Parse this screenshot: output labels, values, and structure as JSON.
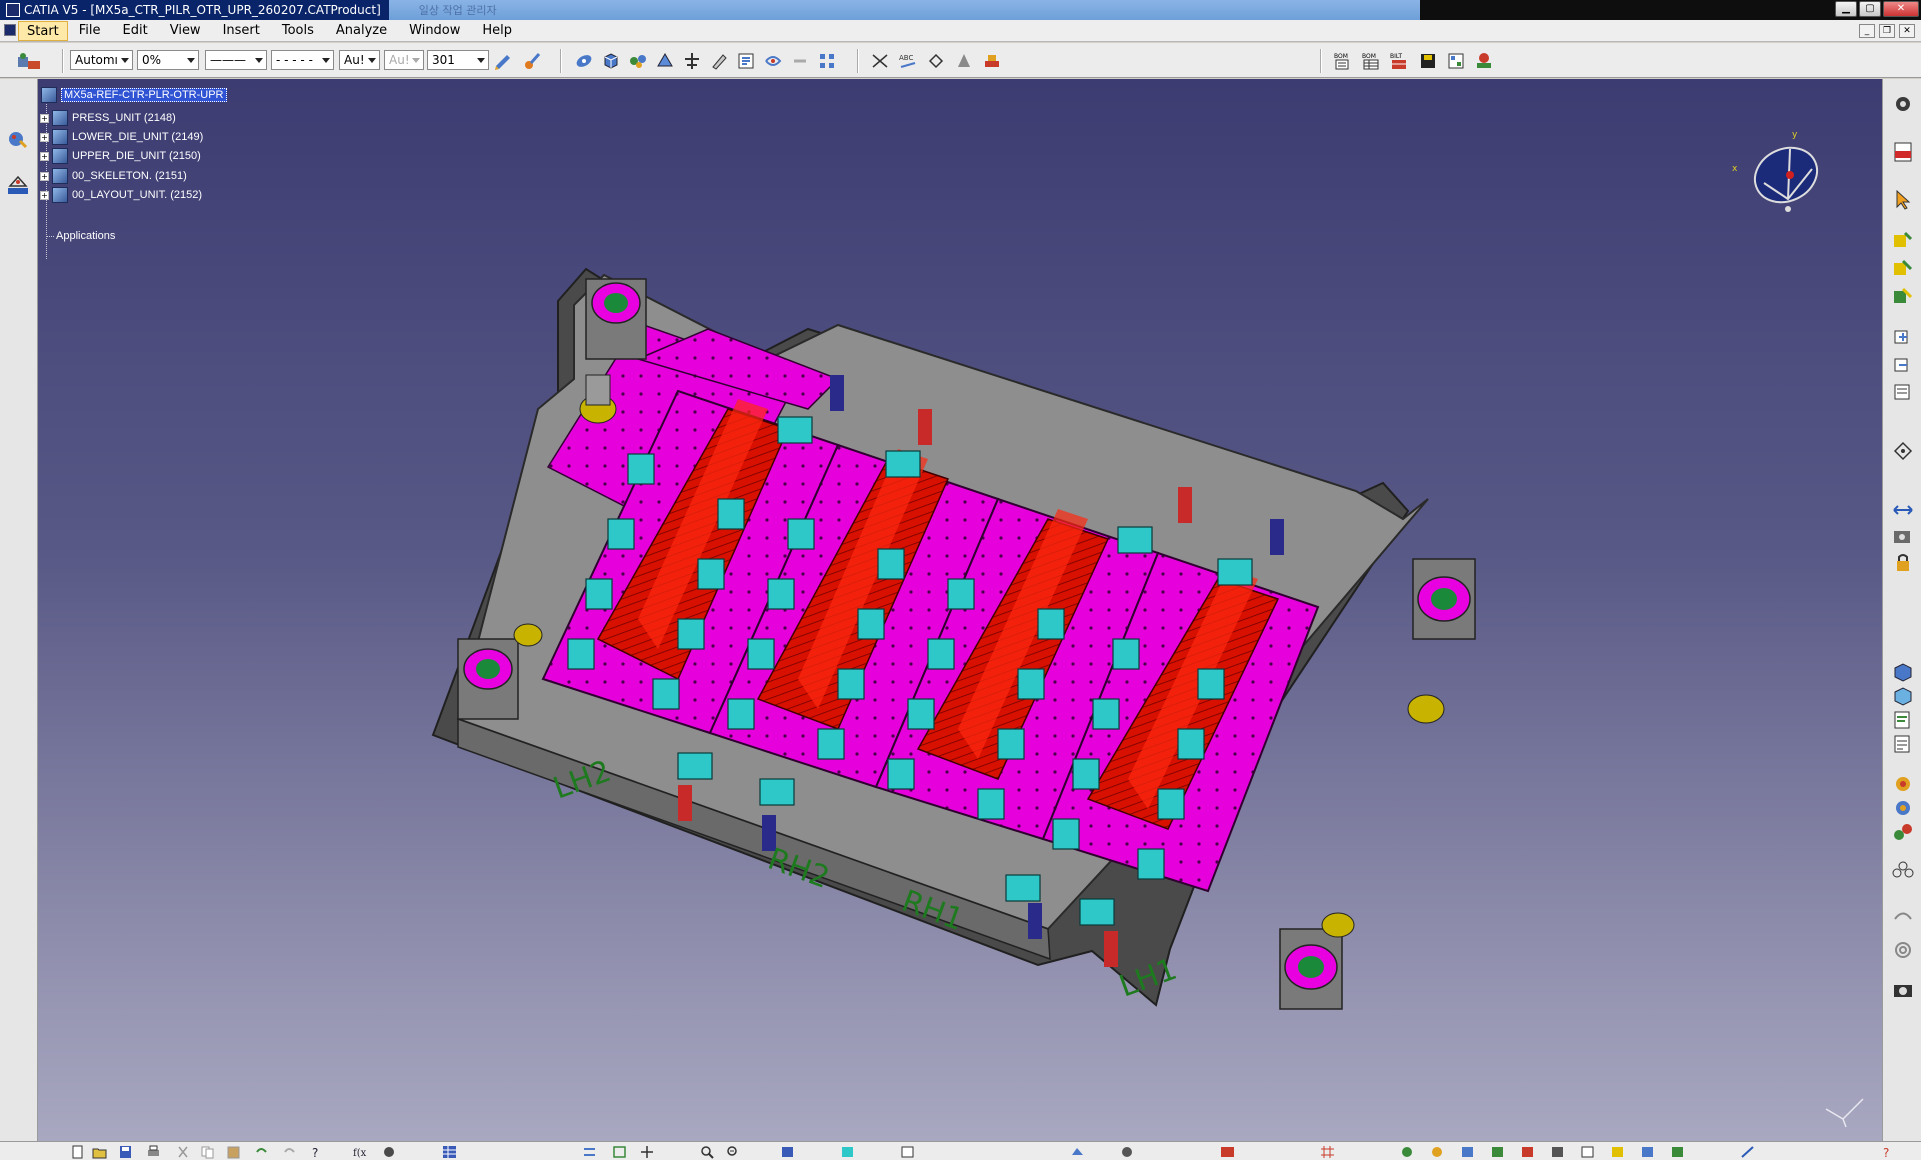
{
  "window": {
    "title": "CATIA V5 - [MX5a_CTR_PILR_OTR_UPR_260207.CATProduct]",
    "ghost_title": "일상 작업 관리자"
  },
  "menu": {
    "items": [
      {
        "key": "start",
        "label": "Start"
      },
      {
        "key": "file",
        "label": "File"
      },
      {
        "key": "edit",
        "label": "Edit"
      },
      {
        "key": "view",
        "label": "View"
      },
      {
        "key": "insert",
        "label": "Insert"
      },
      {
        "key": "tools",
        "label": "Tools"
      },
      {
        "key": "analyze",
        "label": "Analyze"
      },
      {
        "key": "window",
        "label": "Window"
      },
      {
        "key": "help",
        "label": "Help"
      }
    ]
  },
  "toolbar": {
    "color_select": "Automı",
    "transparency_select": "0%",
    "line_weight_select": "———",
    "line_type_select": "- - - - -",
    "point_select": "Au!",
    "layer_disabled_select": "Au!",
    "layer_select": "301"
  },
  "tree": {
    "root": "MX5a-REF-CTR-PLR-OTR-UPR",
    "children": [
      {
        "label": "PRESS_UNIT (2148)"
      },
      {
        "label": "LOWER_DIE_UNIT (2149)"
      },
      {
        "label": "UPPER_DIE_UNIT (2150)"
      },
      {
        "label": "00_SKELETON. (2151)"
      },
      {
        "label": "00_LAYOUT_UNIT. (2152)"
      }
    ],
    "applications": "Applications"
  },
  "model": {
    "labels": [
      "LH2",
      "RH2",
      "RH1",
      "LH1"
    ],
    "colors": {
      "frame": "#8e8e8e",
      "frame_dark": "#5a5a5a",
      "plate": "#e800e0",
      "parts": "#e01000",
      "blocks": "#2ec8c8",
      "posts": "#c8b400",
      "label_green": "#1e7a1e"
    }
  },
  "colors": {
    "viewport_top": "#3c3c72",
    "viewport_bottom": "#a9a8c1",
    "selection": "#2f53d2",
    "titlebar": "#0a246a"
  }
}
